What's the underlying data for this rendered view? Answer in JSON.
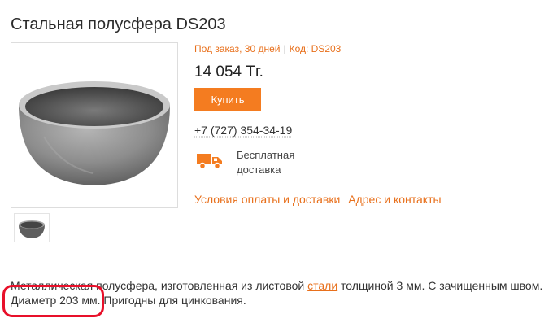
{
  "product": {
    "title": "Стальная полусфера DS203",
    "availability": "Под заказ, 30 дней",
    "separator": "|",
    "code": "Код: DS203",
    "price": "14 054 Тг.",
    "buy_label": "Купить",
    "phone": "+7 (727) 354-34-19",
    "delivery": {
      "line1": "Бесплатная",
      "line2": "доставка"
    },
    "links": {
      "payment": "Условия оплаты и доставки",
      "contacts": "Адрес и контакты"
    }
  },
  "description": {
    "part1": "Металлическая полусфера, изготовленная из листовой ",
    "link": "стали",
    "part2": " толщиной 3 мм. С зачищенным швом.",
    "highlighted": "Диаметр 203 мм.",
    "part3": " Пригодны для цинкования."
  },
  "colors": {
    "accent": "#f47c20",
    "highlight_circle": "#e8102a"
  },
  "icons": {
    "delivery": "truck-icon"
  }
}
